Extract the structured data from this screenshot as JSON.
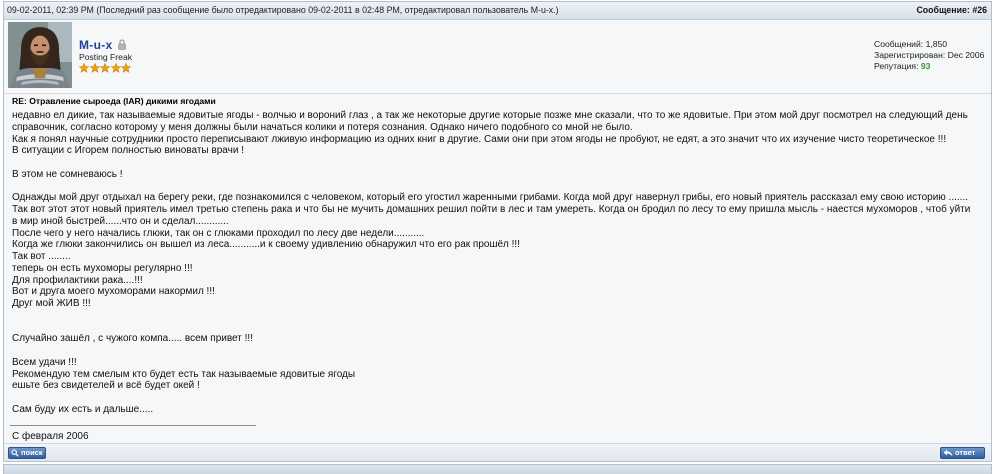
{
  "post": {
    "header": {
      "date": "09-02-2011, 02:39 PM",
      "edit_note": "(Последний раз сообщение было отредактировано 09-02-2011 в 02:48 PM, отредактировал пользователь M-u-x.)",
      "number_label": "Сообщение:",
      "number": "#26"
    },
    "author": {
      "name": "M-u-x",
      "online_status_icon": "lock-icon",
      "user_title": "Posting Freak",
      "rank_stars": 5
    },
    "stats": {
      "posts_label": "Сообщений:",
      "posts_value": "1,850",
      "registered_label": "Зарегистрирован:",
      "registered_value": "Dec 2006",
      "reputation_label": "Репутация:",
      "reputation_value": "93"
    },
    "title": "RE: Отравление сыроеда (IAR) дикими ягодами",
    "body_lines": [
      "недавно ел дикие, так называемые ядовитые ягоды - волчью и вороний глаз , а так же некоторые другие которые позже мне сказали, что то же ядовитые. При этом мой друг посмотрел на следующий день",
      "справочник, согласно которому у меня должны были начаться колики и потеря сознания. Однако ничего подобного со мной не было.",
      "Как я понял научные сотрудники просто переписывают лживую информацию из одних книг в другие. Сами они при этом ягоды не пробуют, не едят, а это значит что их изучение чисто теоретическое !!!",
      "В ситуации с Игорем полностью виноваты врачи !",
      "",
      "В этом не сомневаюсь !",
      "",
      "Однажды мой друг отдыхал на берегу реки, где познакомился с человеком, который его угостил жаренными грибами. Когда мой друг навернул грибы, его новый приятель рассказал ему свою историю .......",
      "Так вот этот этот новый приятель имел третью степень рака и что бы не мучить домашних решил пойти в лес и там умереть. Когда он бродил по лесу то ему пришла мысль - наестся мухоморов , чтоб уйти",
      "в мир иной быстрей......что он и сделал............",
      "После чего у него начались глюки, так он с глюками проходил по лесу две недели...........",
      "Когда же глюки закончились он вышел из леса...........и к своему удивлению обнаружил что его рак прошёл !!!",
      "Так вот ........",
      "теперь он есть мухоморы регулярно !!!",
      "Для профилактики рака....!!!",
      "Вот и друга моего мухоморами накормил !!!",
      "Друг мой ЖИВ !!!",
      "",
      "",
      "Случайно зашёл , с чужого компа..... всем привет !!!",
      "",
      "Всем удачи !!!",
      "Рекомендую тем смелым кто будет есть так называемые ядовитые ягоды",
      "ешьте без свидетелей и всё будет окей !",
      "",
      "Сам буду их есть и дальше....."
    ],
    "signature": "С февраля 2006"
  },
  "footer": {
    "search_button": {
      "label": "поиск",
      "icon": "search-icon"
    },
    "reply_button": {
      "label": "ответ",
      "icon": "reply-arrow-icon"
    }
  },
  "colors": {
    "username": "#22409a",
    "reputation": "#339933",
    "rank_star": "#f6a400",
    "button": "#3a68a8"
  }
}
